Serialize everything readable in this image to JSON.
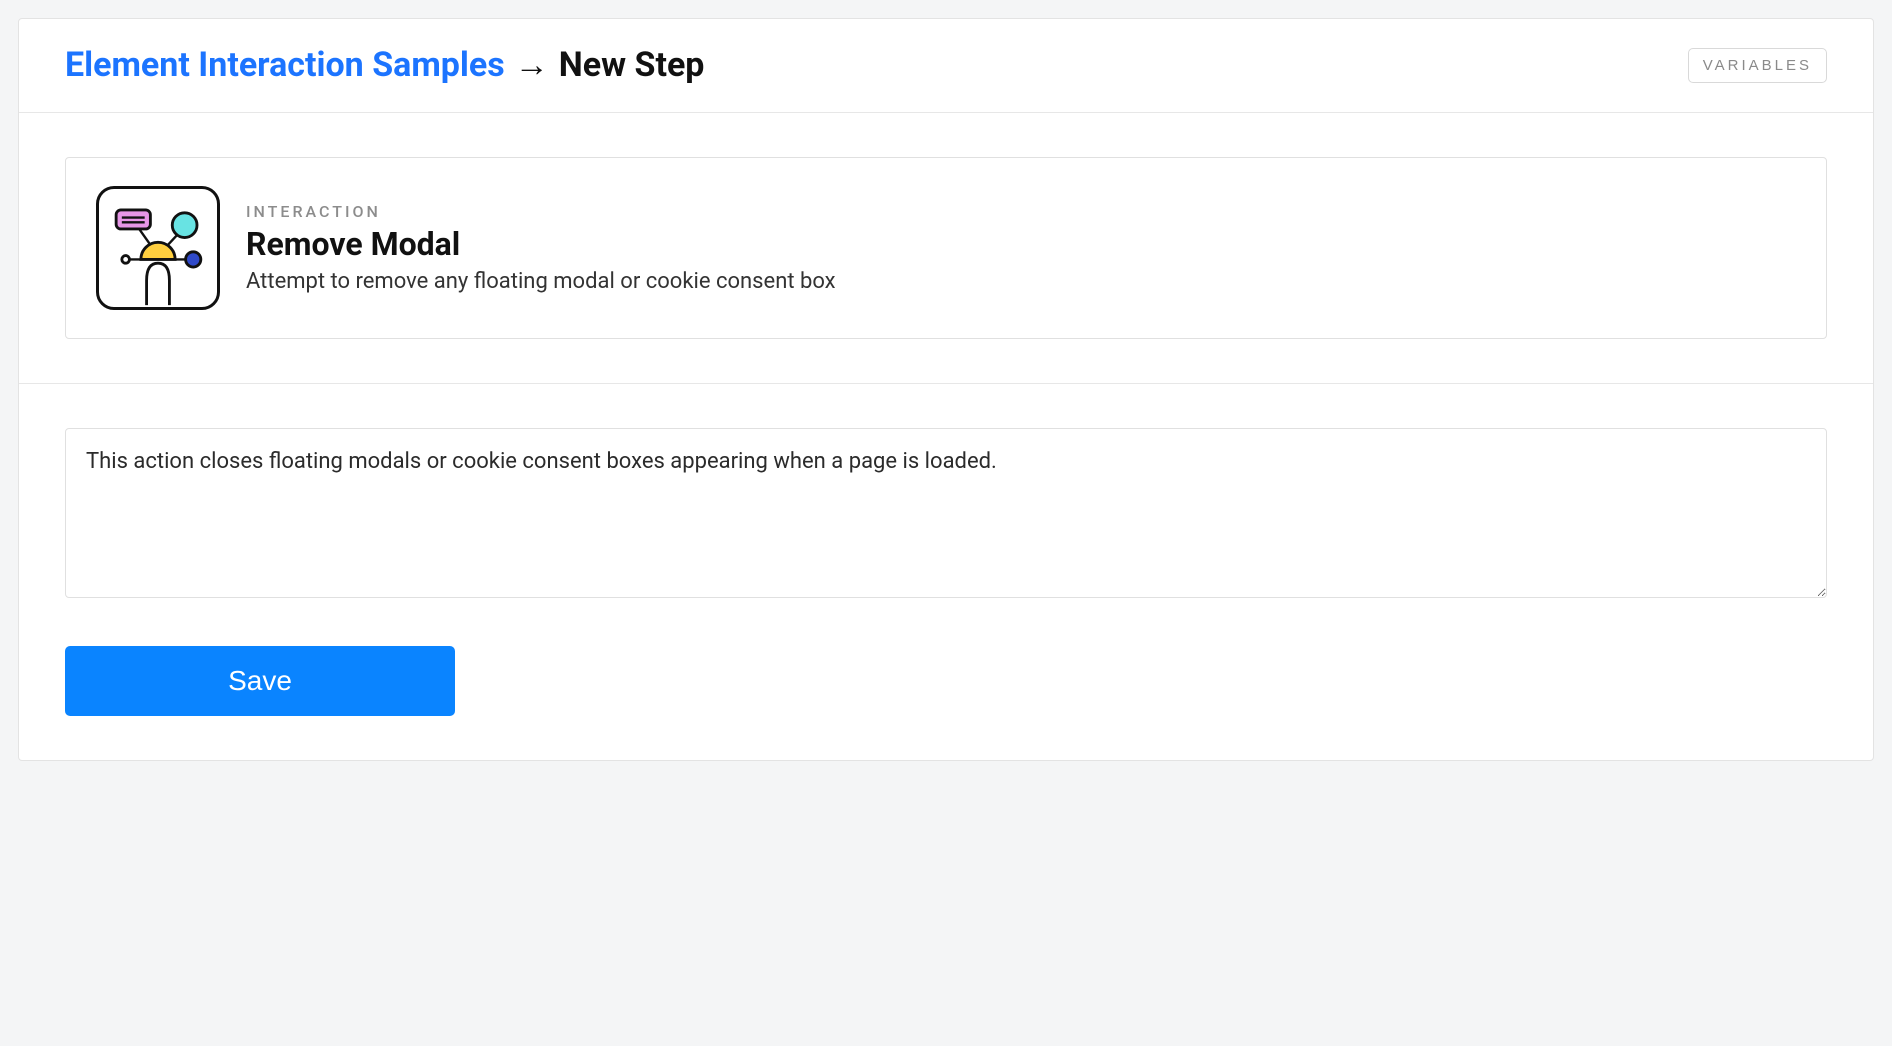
{
  "header": {
    "breadcrumb_parent": "Element Interaction Samples",
    "breadcrumb_arrow": "→",
    "breadcrumb_current": "New Step",
    "variables_button": "VARIABLES"
  },
  "card": {
    "eyebrow": "INTERACTION",
    "title": "Remove Modal",
    "subtitle": "Attempt to remove any floating modal or cookie consent box",
    "icon_name": "interaction-graph-icon"
  },
  "form": {
    "description_value": "This action closes floating modals or cookie consent boxes appearing when a page is loaded.",
    "save_label": "Save"
  },
  "colors": {
    "accent": "#0a84ff",
    "link": "#1c74ff",
    "muted": "#8c8c8c"
  }
}
